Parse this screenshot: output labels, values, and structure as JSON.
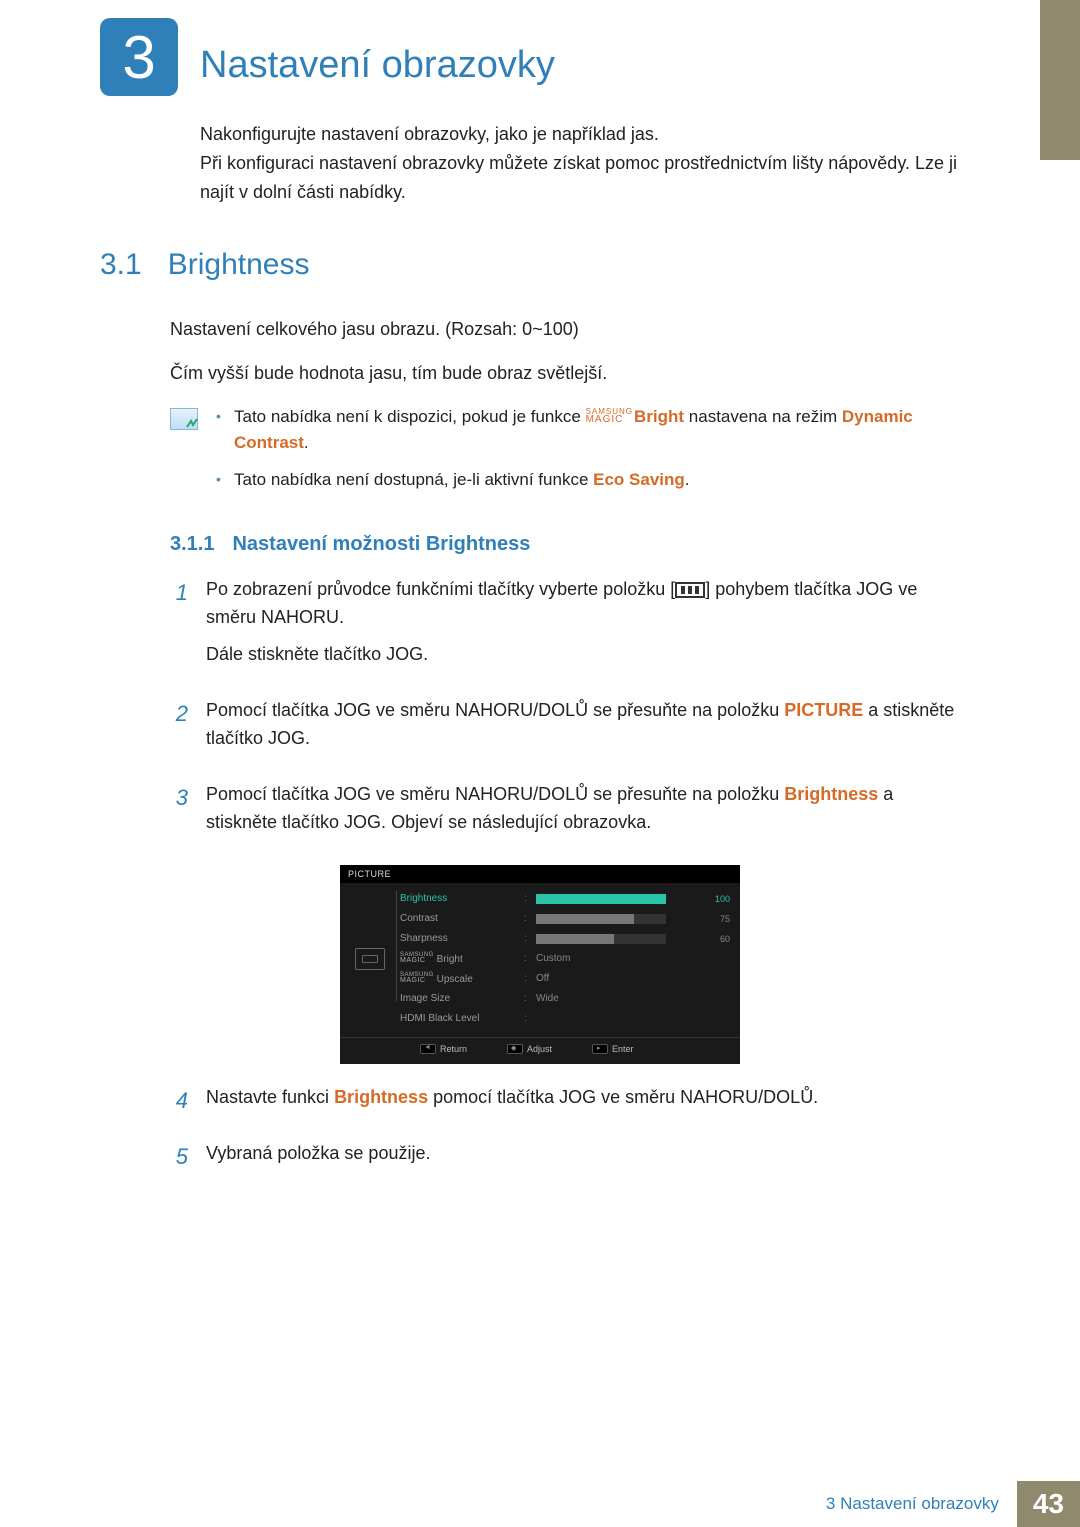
{
  "chapter": {
    "number": "3",
    "title": "Nastavení obrazovky"
  },
  "intro": {
    "p1": "Nakonfigurujte nastavení obrazovky, jako je například jas.",
    "p2": "Při konfiguraci nastavení obrazovky můžete získat pomoc prostřednictvím lišty nápovědy. Lze ji najít v dolní části nabídky."
  },
  "section": {
    "num": "3.1",
    "title": "Brightness"
  },
  "section_body": {
    "p1": "Nastavení celkového jasu obrazu. (Rozsah: 0~100)",
    "p2": "Čím vyšší bude hodnota jasu, tím bude obraz světlejší."
  },
  "notes": {
    "samsung_label": "SAMSUNG",
    "magic_label": "MAGIC",
    "n1_a": "Tato nabídka není k dispozici, pokud je funkce ",
    "n1_bright": "Bright",
    "n1_b": " nastavena na režim ",
    "n1_dc": "Dynamic Contrast",
    "n1_c": ".",
    "n2_a": "Tato nabídka není dostupná, je-li aktivní funkce ",
    "n2_eco": "Eco Saving",
    "n2_b": "."
  },
  "subsection": {
    "num": "3.1.1",
    "title": "Nastavení možnosti Brightness"
  },
  "steps": {
    "s1a": "Po zobrazení průvodce funkčními tlačítky vyberte položku [",
    "s1b": "] pohybem tlačítka JOG ve směru NAHORU.",
    "s1c": "Dále stiskněte tlačítko JOG.",
    "s2a": "Pomocí tlačítka JOG ve směru NAHORU/DOLŮ se přesuňte na položku ",
    "s2_pic": "PICTURE",
    "s2b": " a stiskněte tlačítko JOG.",
    "s3a": "Pomocí tlačítka JOG ve směru NAHORU/DOLŮ se přesuňte na položku ",
    "s3_br": "Brightness",
    "s3b": " a stiskněte tlačítko JOG. Objeví se následující obrazovka.",
    "s4a": "Nastavte funkci ",
    "s4_br": "Brightness",
    "s4b": " pomocí tlačítka JOG ve směru NAHORU/DOLŮ.",
    "s5": "Vybraná položka se použije."
  },
  "osd": {
    "title": "PICTURE",
    "rows": [
      {
        "label": "Brightness",
        "value": 100,
        "max": 100,
        "type": "bar",
        "active": true
      },
      {
        "label": "Contrast",
        "value": 75,
        "max": 100,
        "type": "bar",
        "active": false
      },
      {
        "label": "Sharpness",
        "value": 60,
        "max": 100,
        "type": "bar",
        "active": false
      },
      {
        "label": "Bright",
        "magic": true,
        "text": "Custom",
        "type": "text"
      },
      {
        "label": "Upscale",
        "magic": true,
        "text": "Off",
        "type": "text"
      },
      {
        "label": "Image Size",
        "text": "Wide",
        "type": "text"
      },
      {
        "label": "HDMI Black Level",
        "text": "",
        "type": "text"
      }
    ],
    "footer": {
      "return": "Return",
      "adjust": "Adjust",
      "enter": "Enter"
    },
    "magic_s": "SAMSUNG",
    "magic_m": "MAGIC"
  },
  "footer": {
    "text": "3 Nastavení obrazovky",
    "page": "43"
  }
}
